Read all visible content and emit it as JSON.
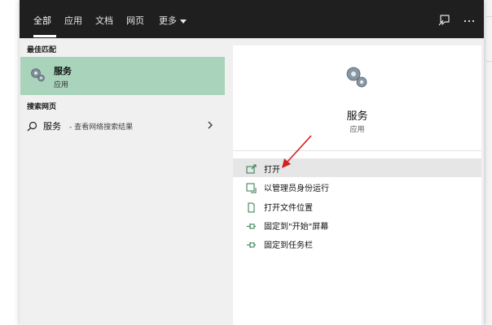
{
  "tabs": [
    {
      "label": "全部",
      "active": true
    },
    {
      "label": "应用"
    },
    {
      "label": "文档"
    },
    {
      "label": "网页"
    },
    {
      "label": "更多"
    }
  ],
  "top_icons": [
    "feedback-icon",
    "more-options-icon"
  ],
  "left": {
    "best_match_title": "最佳匹配",
    "best_match": {
      "name": "服务",
      "type": "应用",
      "icon": "services-gear-icon"
    },
    "web_title": "搜索网页",
    "web_item": {
      "name": "服务",
      "sub": " - 查看网络搜索结果"
    }
  },
  "detail": {
    "name": "服务",
    "type": "应用",
    "actions": [
      {
        "label": "打开",
        "icon": "open-icon"
      },
      {
        "label": "以管理员身份运行",
        "icon": "run-as-admin-icon"
      },
      {
        "label": "打开文件位置",
        "icon": "file-location-icon"
      },
      {
        "label": "固定到\"开始\"屏幕",
        "icon": "pin-icon"
      },
      {
        "label": "固定到任务栏",
        "icon": "pin-icon"
      }
    ]
  },
  "colors": {
    "topbar": "#1f1f1f",
    "selection": "#a9d4bb",
    "annotation_arrow": "#d42020"
  }
}
